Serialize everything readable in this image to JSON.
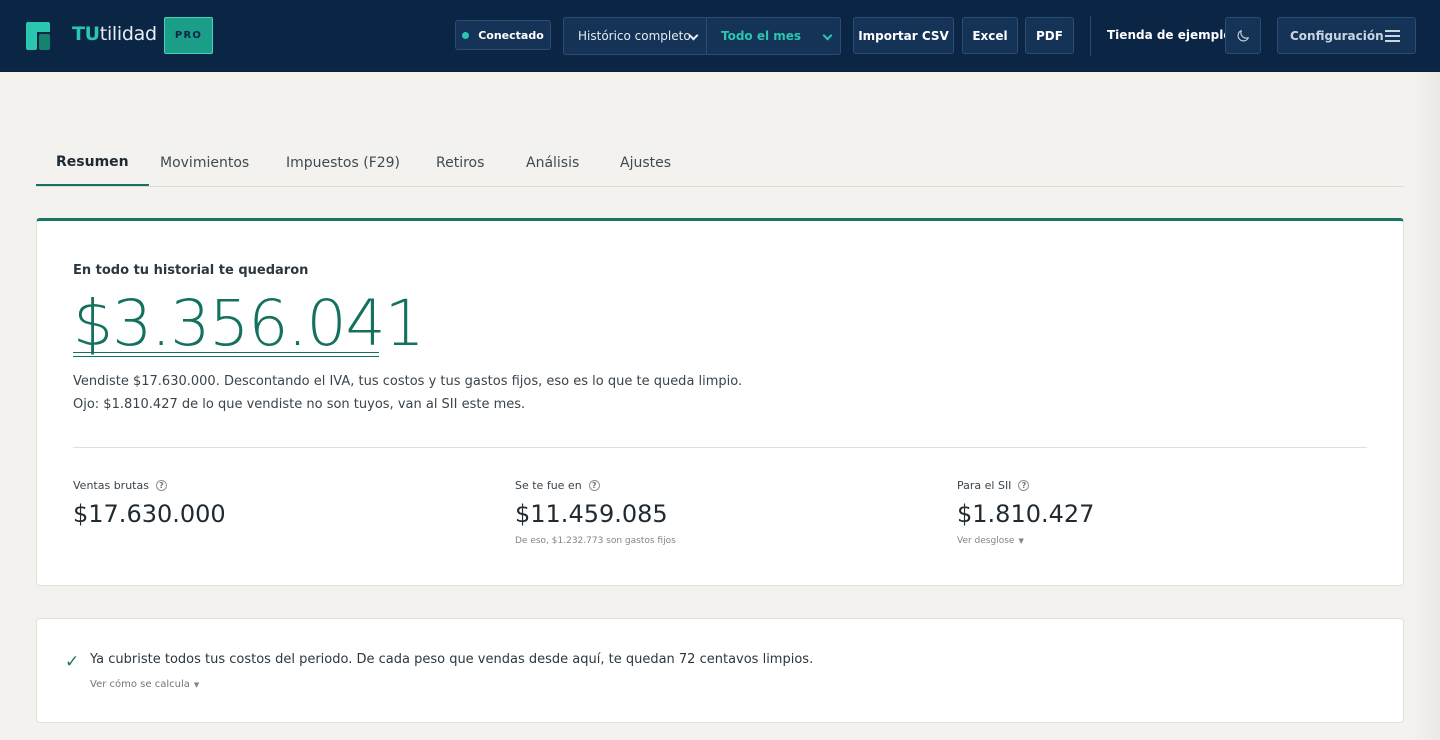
{
  "header": {
    "brand_part1": "TU",
    "brand_part2": "tilidad",
    "plan_badge": "PRO",
    "status_label": "Conectado",
    "history_select": "Histórico completo",
    "period_select": "Todo el mes",
    "import_csv_label": "Importar CSV",
    "excel_label": "Excel",
    "pdf_label": "PDF",
    "store_name": "Tienda de ejemplo",
    "settings_label": "Configuración"
  },
  "tabs": [
    {
      "label": "Resumen",
      "active": true
    },
    {
      "label": "Movimientos",
      "active": false
    },
    {
      "label": "Impuestos (F29)",
      "active": false
    },
    {
      "label": "Retiros",
      "active": false
    },
    {
      "label": "Análisis",
      "active": false
    },
    {
      "label": "Ajustes",
      "active": false
    }
  ],
  "summary": {
    "intro": "En todo tu historial te quedaron",
    "net_amount": "$3.356.041",
    "description_line1": "Vendiste $17.630.000. Descontando el IVA, tus costos y tus gastos fijos, eso es lo que te queda limpio.",
    "description_line2": "Ojo: $1.810.427 de lo que vendiste no son tuyos, van al SII este mes.",
    "stats": [
      {
        "label": "Ventas brutas",
        "value": "$17.630.000",
        "sub": ""
      },
      {
        "label": "Se te fue en",
        "value": "$11.459.085",
        "sub": "De eso, $1.232.773 son gastos fijos"
      },
      {
        "label": "Para el SII",
        "value": "$1.810.427",
        "sub": "Ver desglose"
      }
    ]
  },
  "breakeven": {
    "message": "Ya cubriste todos tus costos del periodo. De cada peso que vendas desde aquí, te quedan 72 centavos limpios.",
    "link": "Ver cómo se calcula"
  },
  "colors": {
    "header_bg": "#0b2545",
    "accent": "#2bc6b0",
    "primary_green": "#14705f",
    "page_bg": "#f3f2ee"
  },
  "icons": {
    "connected": "status-dot-icon",
    "theme": "moon-icon",
    "menu": "hamburger-icon",
    "help": "question-circle-icon",
    "success": "check-icon"
  }
}
